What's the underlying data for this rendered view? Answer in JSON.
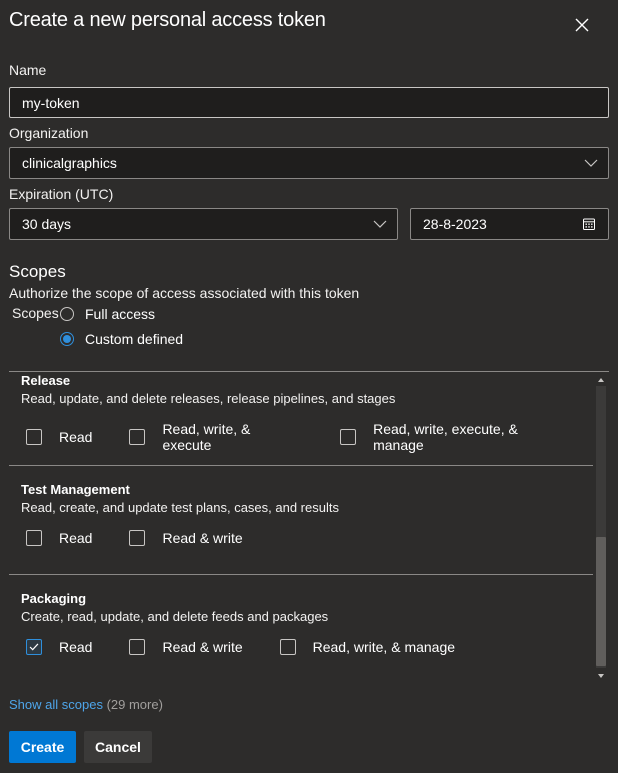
{
  "dialog": {
    "title": "Create a new personal access token",
    "close_icon": "close-icon"
  },
  "name": {
    "label": "Name",
    "value": "my-token"
  },
  "organization": {
    "label": "Organization",
    "value": "clinicalgraphics"
  },
  "expiration": {
    "label": "Expiration (UTC)",
    "value": "30 days",
    "date": "28-8-2023"
  },
  "scopes": {
    "heading": "Scopes",
    "description": "Authorize the scope of access associated with this token",
    "group_label": "Scopes",
    "options": [
      {
        "label": "Full access",
        "selected": false
      },
      {
        "label": "Custom defined",
        "selected": true
      }
    ],
    "sections": [
      {
        "title": "Release",
        "description": "Read, update, and delete releases, release pipelines, and stages",
        "checks": [
          {
            "label": "Read",
            "checked": false
          },
          {
            "label": "Read, write, & execute",
            "checked": false
          },
          {
            "label": "Read, write, execute, & manage",
            "checked": false
          }
        ]
      },
      {
        "title": "Test Management",
        "description": "Read, create, and update test plans, cases, and results",
        "checks": [
          {
            "label": "Read",
            "checked": false
          },
          {
            "label": "Read & write",
            "checked": false
          }
        ]
      },
      {
        "title": "Packaging",
        "description": "Create, read, update, and delete feeds and packages",
        "checks": [
          {
            "label": "Read",
            "checked": true
          },
          {
            "label": "Read & write",
            "checked": false
          },
          {
            "label": "Read, write, & manage",
            "checked": false
          }
        ]
      }
    ],
    "show_all": "Show all scopes",
    "more_count": "(29 more)"
  },
  "buttons": {
    "create": "Create",
    "cancel": "Cancel"
  },
  "colors": {
    "background": "#2d2c2b",
    "accent": "#0078d4",
    "link": "#4ea5ea"
  }
}
